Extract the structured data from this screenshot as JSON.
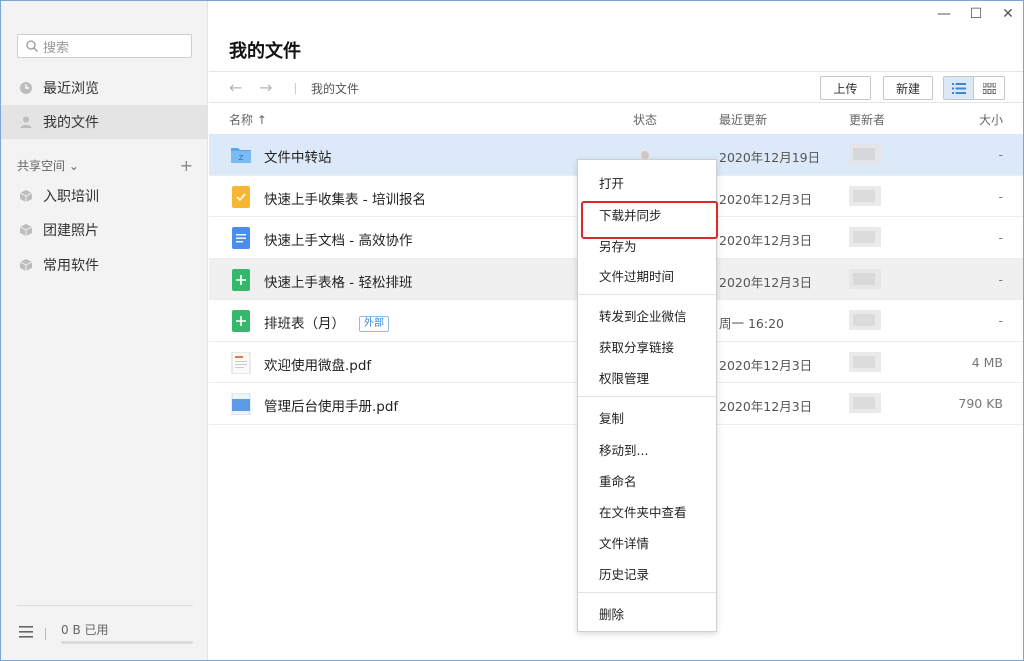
{
  "window": {
    "controls": [
      "—",
      "☐",
      "✕"
    ]
  },
  "sidebar": {
    "search_placeholder": "搜索",
    "items": [
      {
        "label": "最近浏览",
        "icon": "clock-icon"
      },
      {
        "label": "我的文件",
        "icon": "user-icon"
      }
    ],
    "section_label": "共享空间 ⌄",
    "section_add": "+",
    "shared": [
      {
        "label": "入职培训",
        "icon": "cube-icon"
      },
      {
        "label": "团建照片",
        "icon": "cube-icon"
      },
      {
        "label": "常用软件",
        "icon": "cube-icon"
      }
    ],
    "usage": "0 B 已用"
  },
  "main": {
    "title": "我的文件",
    "breadcrumb": "我的文件",
    "upload_label": "上传",
    "new_label": "新建",
    "columns": {
      "name": "名称 ↑",
      "status": "状态",
      "updated": "最近更新",
      "updater": "更新者",
      "size": "大小"
    },
    "files": [
      {
        "name": "文件中转站",
        "icon": "folder-icon",
        "date": "2020年12月19日",
        "size": "-",
        "state": "selected"
      },
      {
        "name": "快速上手收集表 - 培训报名",
        "icon": "form-icon",
        "date": "2020年12月3日",
        "size": "-",
        "state": ""
      },
      {
        "name": "快速上手文档 - 高效协作",
        "icon": "doc-icon",
        "date": "2020年12月3日",
        "size": "-",
        "state": ""
      },
      {
        "name": "快速上手表格 - 轻松排班",
        "icon": "sheet-icon",
        "date": "2020年12月3日",
        "size": "-",
        "state": "hover"
      },
      {
        "name": "排班表（月）",
        "icon": "sheet-icon",
        "date": "周一 16:20",
        "size": "-",
        "state": "",
        "tag": "外部"
      },
      {
        "name": "欢迎使用微盘.pdf",
        "icon": "pdf-icon",
        "date": "2020年12月3日",
        "size": "4 MB",
        "state": ""
      },
      {
        "name": "管理后台使用手册.pdf",
        "icon": "pdf-blue-icon",
        "date": "2020年12月3日",
        "size": "790 KB",
        "state": ""
      }
    ]
  },
  "context_menu": {
    "items": [
      "打开",
      "下载并同步",
      "另存为",
      "文件过期时间",
      "转发到企业微信",
      "获取分享链接",
      "权限管理",
      "复制",
      "移动到...",
      "重命名",
      "在文件夹中查看",
      "文件详情",
      "历史记录",
      "删除"
    ]
  },
  "colors": {
    "selected_row": "#dce9f8",
    "highlight": "#d92b2b",
    "accent": "#3b86d8"
  }
}
